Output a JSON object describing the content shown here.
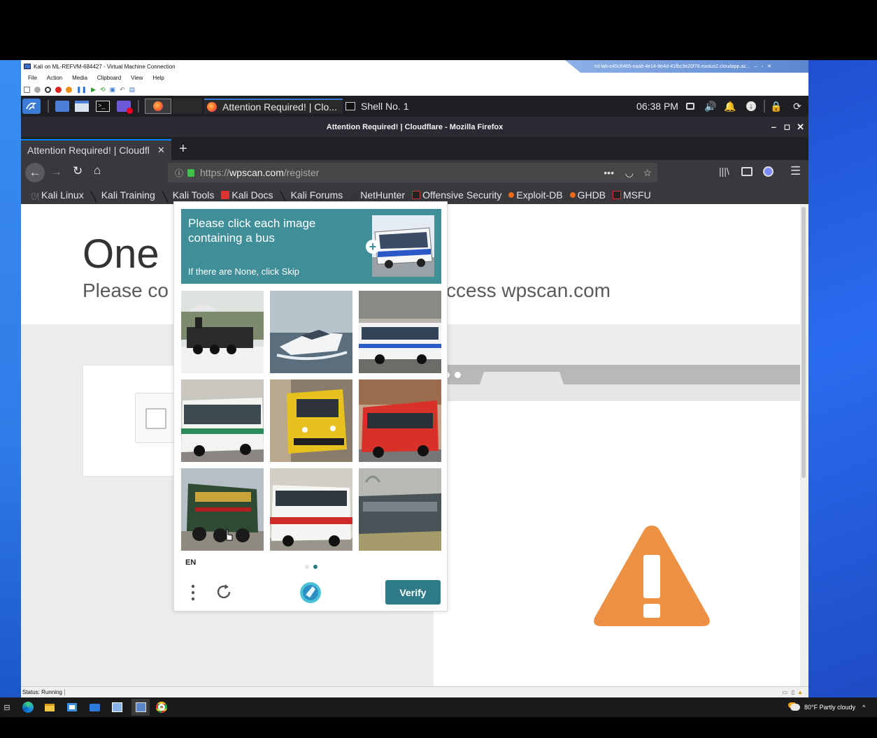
{
  "vm": {
    "title": "Kali on ML-REFVM-684427 - Virtual Machine Connection",
    "rdp_title": "ml-lab-e45c6465-eaa8-4e14-8e4d-41fbc3e20f78.eastus2.cloudapp.az...",
    "menu": [
      "File",
      "Action",
      "Media",
      "Clipboard",
      "View",
      "Help"
    ],
    "status": "Status: Running"
  },
  "kali_panel": {
    "taskbar_items": [
      {
        "label": "Attention Required! | Clo...",
        "icon": "firefox-icon"
      },
      {
        "label": "Shell No. 1",
        "icon": "terminal-icon"
      }
    ],
    "clock": "06:38 PM"
  },
  "firefox": {
    "window_title": "Attention Required! | Cloudflare - Mozilla Firefox",
    "tab_label": "Attention Required! | Cloudfl",
    "url_prefix": "https://",
    "url_host": "wpscan.com",
    "url_path": "/register",
    "bookmarks": [
      {
        "label": "Kali Linux",
        "icon": "kali-icon"
      },
      {
        "label": "Kali Training",
        "icon": "kali-dragon-icon"
      },
      {
        "label": "Kali Tools",
        "icon": "kali-dragon-icon"
      },
      {
        "label": "Kali Docs",
        "icon": "docs-icon"
      },
      {
        "label": "Kali Forums",
        "icon": "kali-dragon-icon"
      },
      {
        "label": "NetHunter",
        "icon": "nethunter-icon"
      },
      {
        "label": "Offensive Security",
        "icon": "offsec-icon"
      },
      {
        "label": "Exploit-DB",
        "icon": "exploitdb-icon"
      },
      {
        "label": "GHDB",
        "icon": "exploitdb-icon"
      },
      {
        "label": "MSFU",
        "icon": "offsec-icon"
      }
    ]
  },
  "page": {
    "title": "One",
    "subtitle_left": "Please co",
    "subtitle_right": "ccess wpscan.com"
  },
  "captcha": {
    "prompt": "Please click each image containing a bus",
    "sub": "If there are None, click Skip",
    "lang": "EN",
    "verify_label": "Verify",
    "tiles": [
      {
        "content": "steam locomotive in snow",
        "contains_bus": false
      },
      {
        "content": "speedboat on water",
        "contains_bus": false
      },
      {
        "content": "white and blue city bus",
        "contains_bus": true
      },
      {
        "content": "white coach bus with green stripe",
        "contains_bus": true
      },
      {
        "content": "yellow train at platform",
        "contains_bus": false
      },
      {
        "content": "red double-door city bus",
        "contains_bus": true
      },
      {
        "content": "green steam locomotive",
        "contains_bus": false
      },
      {
        "content": "white bus with red stripe",
        "contains_bus": true
      },
      {
        "content": "old passenger railcar",
        "contains_bus": false
      }
    ]
  },
  "taskbar": {
    "weather": "80°F  Partly cloudy"
  },
  "colors": {
    "captcha_header": "#3f8e98",
    "verify_button": "#2e7a86",
    "warning_orange": "#ec9144"
  }
}
